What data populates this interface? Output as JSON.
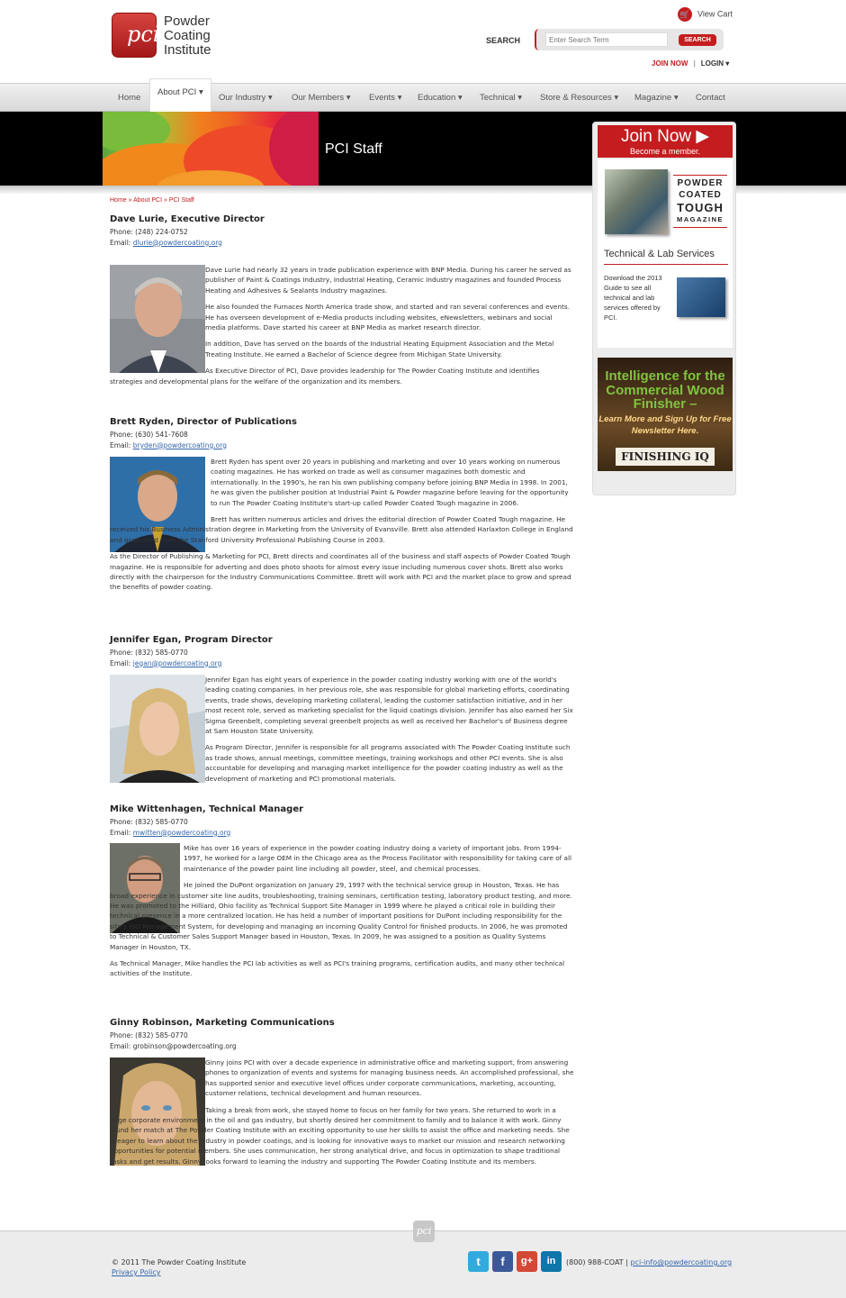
{
  "header": {
    "logo_text": "pci",
    "brand_line1": "Powder",
    "brand_line2": "Coating",
    "brand_line3": "Institute",
    "cart_label": "View Cart",
    "search_label": "SEARCH",
    "search_placeholder": "Enter Search Term",
    "search_button": "SEARCH",
    "join_label": "JOIN NOW",
    "login_label": "LOGIN"
  },
  "nav": {
    "items": [
      {
        "label": "Home"
      },
      {
        "label": "About PCI",
        "active": true
      },
      {
        "label": "Our Industry"
      },
      {
        "label": "Our Members"
      },
      {
        "label": "Events"
      },
      {
        "label": "Education"
      },
      {
        "label": "Technical"
      },
      {
        "label": "Store & Resources"
      },
      {
        "label": "Magazine"
      },
      {
        "label": "Contact"
      }
    ]
  },
  "banner": {
    "title": "PCI Staff"
  },
  "breadcrumb": {
    "home": "Home",
    "about": "About PCI",
    "current": "PCI Staff"
  },
  "staff": [
    {
      "name": "Dave Lurie, Executive Director",
      "phone": "Phone: (248) 224-0752",
      "email_label": "Email:",
      "email": "dlurie@powdercoating.org",
      "bio": [
        "Dave Lurie had nearly 32 years in trade publication experience with BNP Media. During his career he served as publisher of Paint & Coatings Industry, Industrial Heating, Ceramic Industry magazines and founded Process Heating and Adhesives & Sealants Industry magazines.",
        "He also founded the Furnaces North America trade show, and started and ran several conferences and events. He has overseen development of e-Media products including websites, eNewsletters, webinars and social media platforms. Dave started his career at BNP Media as market research director.",
        "In addition, Dave has served on the boards of the Industrial Heating Equipment Association and the Metal Treating Institute. He earned a Bachelor of Science degree from Michigan State University.",
        "As Executive Director of PCI, Dave provides leadership for The Powder Coating Institute and identifies strategies and developmental plans for the welfare of the organization and its members."
      ]
    },
    {
      "name": "Brett Ryden, Director of Publications",
      "phone": "Phone: (630) 541-7608",
      "email_label": "Email:",
      "email": "bryden@powdercoating.org",
      "bio": [
        "Brett Ryden has spent over 20 years in publishing and marketing and over 10 years working on numerous coating magazines. He has worked on trade as well as consumer magazines both domestic and internationally. In the 1990's, he ran his own publishing company before joining BNP Media in 1998. In 2001, he was given the publisher position at Industrial Paint & Powder magazine before leaving for the opportunity to run The Powder Coating Institute's start-up called Powder Coated Tough magazine in 2006.",
        "Brett has written numerous articles and drives the editorial direction of Powder Coated Tough magazine. He received his Business Administration degree in Marketing from the University of Evansville. Brett also attended Harlaxton College in England and graduated from the Stanford University Professional Publishing Course in 2003.",
        "As the Director of Publishing & Marketing for PCI, Brett directs and coordinates all of the business and staff aspects of Powder Coated Tough magazine. He is responsible for adverting and does photo shoots for almost every issue including numerous cover shots. Brett also works directly with the chairperson for the Industry Communications Committee. Brett will work with PCI and the market place to grow and spread the benefits of powder coating."
      ]
    },
    {
      "name": "Jennifer Egan, Program Director",
      "phone": "Phone: (832) 585-0770",
      "email_label": "Email:",
      "email": "jegan@powdercoating.org",
      "bio": [
        "Jennifer Egan has eight years of experience in the powder coating industry working with one of the world's leading coating companies. In her previous role, she was responsible for global marketing efforts, coordinating events, trade shows, developing marketing collateral, leading the customer satisfaction initiative, and in her most recent role, served as marketing specialist for the liquid coatings division. Jennifer has also earned her Six Sigma Greenbelt, completing several greenbelt projects as well as received her Bachelor's of Business degree at Sam Houston State University.",
        "As Program Director, Jennifer is responsible for all programs associated with The Powder Coating Institute such as trade shows, annual meetings, committee meetings, training workshops and other PCI events. She is also accountable for developing and managing market intelligence for the powder coating industry as well as the development of marketing and PCI promotional materials."
      ]
    },
    {
      "name": "Mike Wittenhagen, Technical Manager",
      "phone": "Phone: (832) 585-0770",
      "email_label": "Email:",
      "email": "mwitten@powdercoating.org",
      "bio": [
        "Mike has over 16 years of experience in the powder coating industry doing a variety of important jobs. From 1994-1997, he worked for a large OEM in the Chicago area as the Process Facilitator with responsibility for taking care of all maintenance of the powder paint line including all powder, steel, and chemical processes.",
        "He joined the DuPont organization on January 29, 1997 with the technical service group in Houston, Texas. He has broad experience in customer site line audits, troubleshooting, training seminars, certification testing, laboratory product testing, and more. He was promoted to the Hilliard, Ohio facility as Technical Support Site Manager in 1999 where he played a critical role in building their technical presence in a more centralized location. He has held a number of important positions for DuPont including responsibility for the site's ISO Management System, for developing and managing an incoming Quality Control for finished products. In 2006, he was promoted to Technical & Customer Sales Support Manager based in Houston, Texas. In 2009, he was assigned to a position as Quality Systems Manager in Houston, TX.",
        "As Technical Manager, Mike handles the PCI lab activities as well as PCI's training programs, certification audits, and many other technical activities of the Institute."
      ]
    },
    {
      "name": "Ginny Robinson, Marketing Communications",
      "phone": "Phone: (832) 585-0770",
      "email_label": "Email:",
      "email": "grobinson@powdercoating.org",
      "bio": [
        "Ginny joins PCI with over a decade experience in administrative office and marketing support, from answering phones to organization of events and systems for managing business needs. An accomplished professional, she has supported senior and executive level offices under corporate communications, marketing, accounting, customer relations, technical development and human resources.",
        "Taking a break from work, she stayed home to focus on her family for two years. She returned to work in a large corporate environment in the oil and gas industry, but shortly desired her commitment to family and to balance it with work. Ginny found her match at The Powder Coating Institute with an exciting opportunity to use her skills to assist the office and marketing needs. She is eager to learn about the industry in powder coatings, and is looking for innovative ways to market our mission and research networking opportunities for potential members. She uses communication, her strong analytical drive, and focus in optimization to shape traditional tasks and get results. Ginny looks forward to learning the industry and supporting The Powder Coating Institute and its members."
      ]
    }
  ],
  "sidebar": {
    "join_title": "Join Now ▶",
    "join_sub": "Become a member.",
    "mag_line1": "POWDER",
    "mag_line2": "COATED",
    "mag_line3": "TOUGH",
    "mag_line4": "MAGAZINE",
    "tech_heading": "Technical & Lab Services",
    "tech_text": "Download the 2013 Guide to see all technical and lab services offered by PCI.",
    "ad_headline": "Intelligence for the Commercial Wood Finisher –",
    "ad_sub": "Learn More and Sign Up for Free Newsletter Here.",
    "ad_logo": "FINISHING IQ"
  },
  "footer": {
    "copyright": "© 2011 The Powder Coating Institute",
    "privacy": "Privacy Policy",
    "phone": "(800) 988-COAT",
    "separator": "|",
    "email": "pci-info@powdercoating.org",
    "logo_text": "pci"
  }
}
